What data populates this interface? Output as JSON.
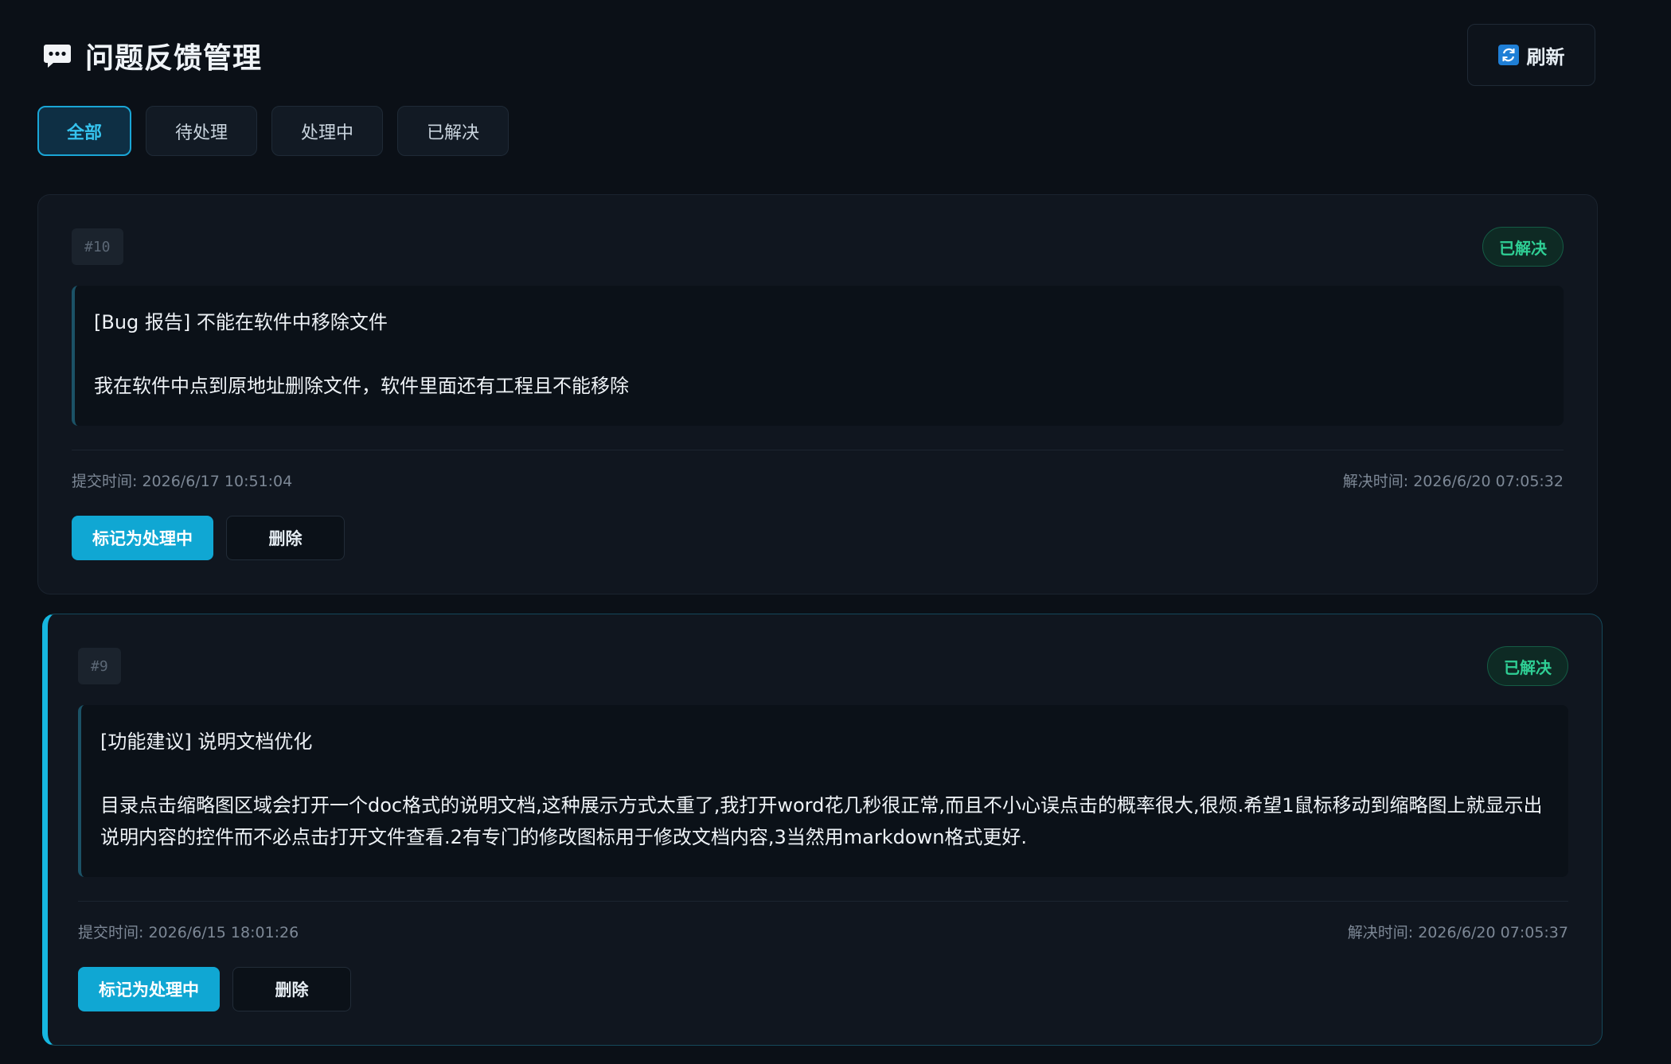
{
  "header": {
    "title": "问题反馈管理",
    "title_icon": "chat-bubble-icon",
    "refresh_label": "刷新",
    "refresh_icon": "refresh-icon"
  },
  "tabs": [
    {
      "label": "全部",
      "active": true
    },
    {
      "label": "待处理",
      "active": false
    },
    {
      "label": "处理中",
      "active": false
    },
    {
      "label": "已解决",
      "active": false
    }
  ],
  "colors": {
    "accent": "#16b7e0",
    "status_resolved": "#2fcf95",
    "background": "#0b1017"
  },
  "feedback": [
    {
      "id": "#10",
      "status": "已解决",
      "title": "[Bug 报告] 不能在软件中移除文件",
      "body": "我在软件中点到原地址删除文件，软件里面还有工程且不能移除",
      "submitted": "提交时间: 2026/6/17 10:51:04",
      "resolved": "解决时间: 2026/6/20 07:05:32",
      "primary_action": "标记为处理中",
      "delete_label": "删除"
    },
    {
      "id": "#9",
      "status": "已解决",
      "title": "[功能建议] 说明文档优化",
      "body": "目录点击缩略图区域会打开一个doc格式的说明文档,这种展示方式太重了,我打开word花几秒很正常,而且不小心误点击的概率很大,很烦.希望1鼠标移动到缩略图上就显示出说明内容的控件而不必点击打开文件查看.2有专门的修改图标用于修改文档内容,3当然用markdown格式更好.",
      "submitted": "提交时间: 2026/6/15 18:01:26",
      "resolved": "解决时间: 2026/6/20 07:05:37",
      "primary_action": "标记为处理中",
      "delete_label": "删除"
    }
  ]
}
